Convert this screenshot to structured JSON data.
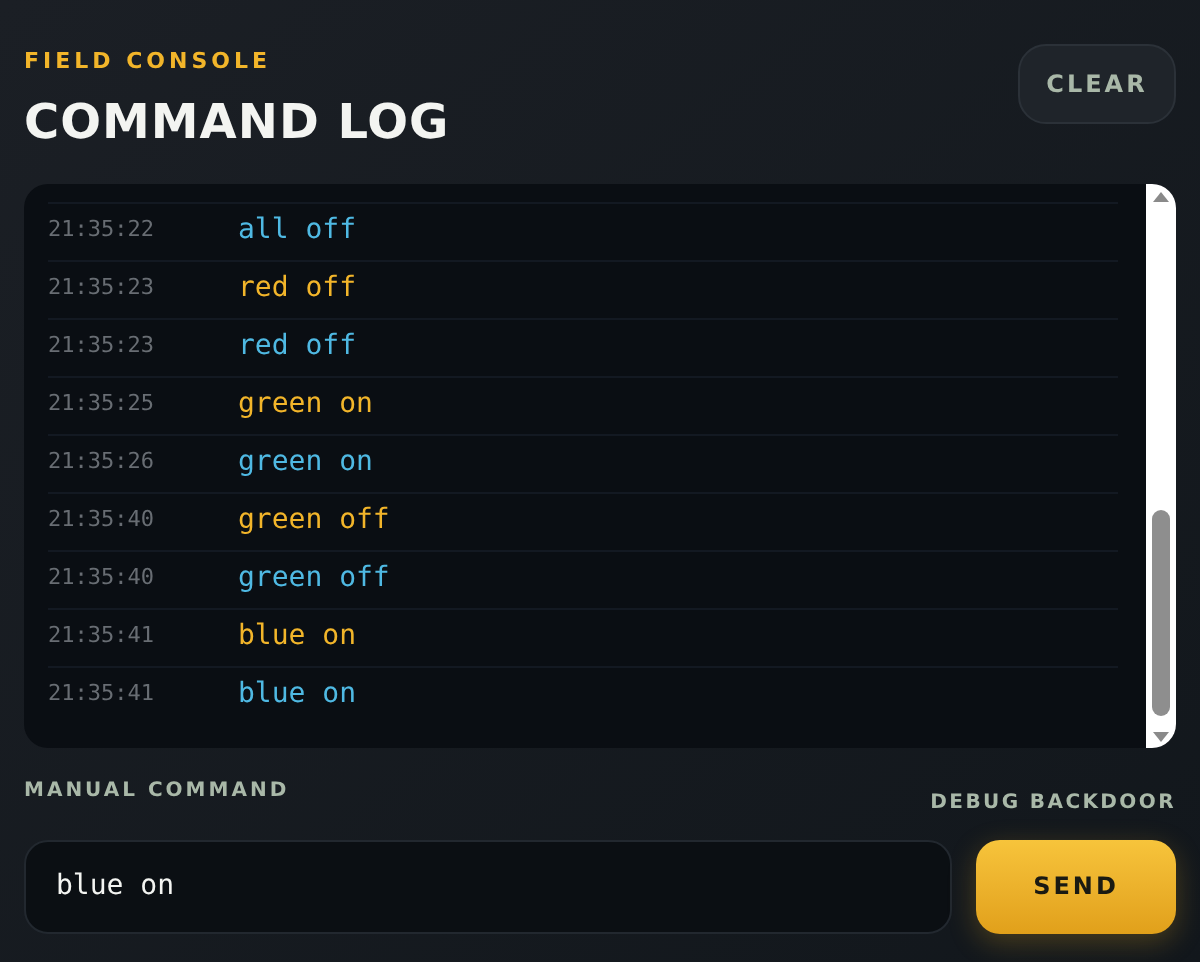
{
  "header": {
    "eyebrow": "FIELD CONSOLE",
    "title": "COMMAND LOG",
    "clear_button": "CLEAR"
  },
  "log": [
    {
      "time": "21:35:22",
      "command": "all off",
      "kind": "received"
    },
    {
      "time": "21:35:23",
      "command": "red off",
      "kind": "sent"
    },
    {
      "time": "21:35:23",
      "command": "red off",
      "kind": "received"
    },
    {
      "time": "21:35:25",
      "command": "green on",
      "kind": "sent"
    },
    {
      "time": "21:35:26",
      "command": "green on",
      "kind": "received"
    },
    {
      "time": "21:35:40",
      "command": "green off",
      "kind": "sent"
    },
    {
      "time": "21:35:40",
      "command": "green off",
      "kind": "received"
    },
    {
      "time": "21:35:41",
      "command": "blue on",
      "kind": "sent"
    },
    {
      "time": "21:35:41",
      "command": "blue on",
      "kind": "received"
    }
  ],
  "manual": {
    "label": "MANUAL COMMAND",
    "note": "DEBUG BACKDOOR",
    "value": "blue on",
    "send_button": "SEND"
  }
}
